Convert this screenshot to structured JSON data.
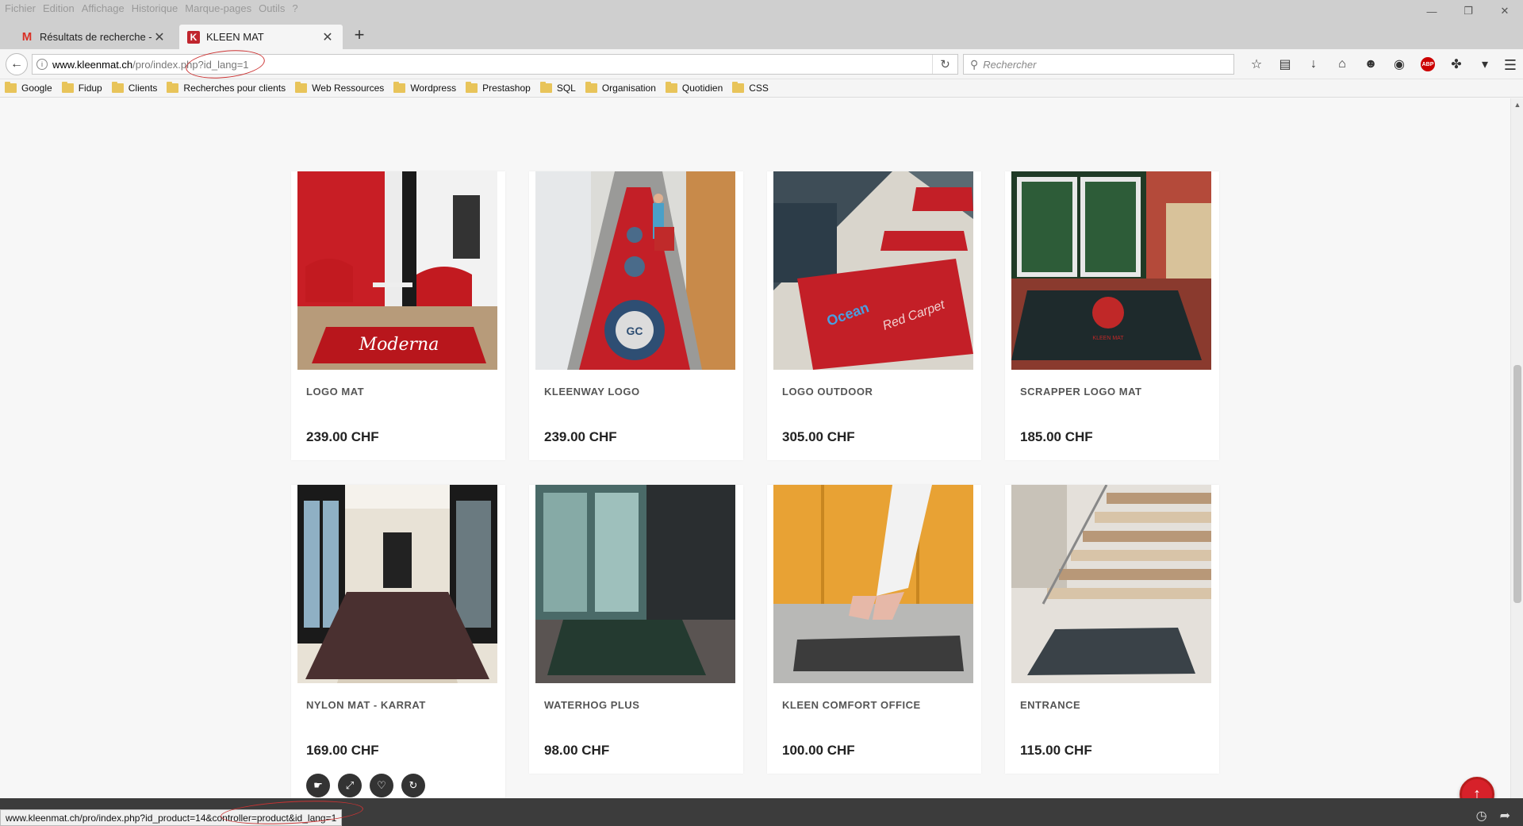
{
  "menu": [
    "Fichier",
    "Edition",
    "Affichage",
    "Historique",
    "Marque-pages",
    "Outils",
    "?"
  ],
  "tabs": [
    {
      "title": "Résultats de recherche - je...",
      "icon": "gmail-icon"
    },
    {
      "title": "KLEEN MAT",
      "icon": "kleen-mat-icon"
    }
  ],
  "url": {
    "domain": "www.kleenmat.ch",
    "path": "/pro/index.php?id_lang=1"
  },
  "search": {
    "placeholder": "Rechercher"
  },
  "bookmarks": [
    "Google",
    "Fidup",
    "Clients",
    "Recherches pour clients",
    "Web Ressources",
    "Wordpress",
    "Prestashop",
    "SQL",
    "Organisation",
    "Quotidien",
    "CSS"
  ],
  "products": [
    {
      "name": "LOGO MAT",
      "price": "239.00 CHF"
    },
    {
      "name": "KLEENWAY LOGO",
      "price": "239.00 CHF"
    },
    {
      "name": "LOGO OUTDOOR",
      "price": "305.00 CHF"
    },
    {
      "name": "SCRAPPER LOGO MAT",
      "price": "185.00 CHF"
    },
    {
      "name": "NYLON MAT - KARRAT",
      "price": "169.00 CHF"
    },
    {
      "name": "WATERHOG PLUS",
      "price": "98.00 CHF"
    },
    {
      "name": "KLEEN COMFORT OFFICE",
      "price": "100.00 CHF"
    },
    {
      "name": "ENTRANCE",
      "price": "115.00 CHF"
    }
  ],
  "status": {
    "link": "www.kleenmat.ch/pro/index.php?id_product=14&controller=product&id_lang=1"
  },
  "colors": {
    "accent": "#d7212a",
    "brand": "#c0262e"
  }
}
